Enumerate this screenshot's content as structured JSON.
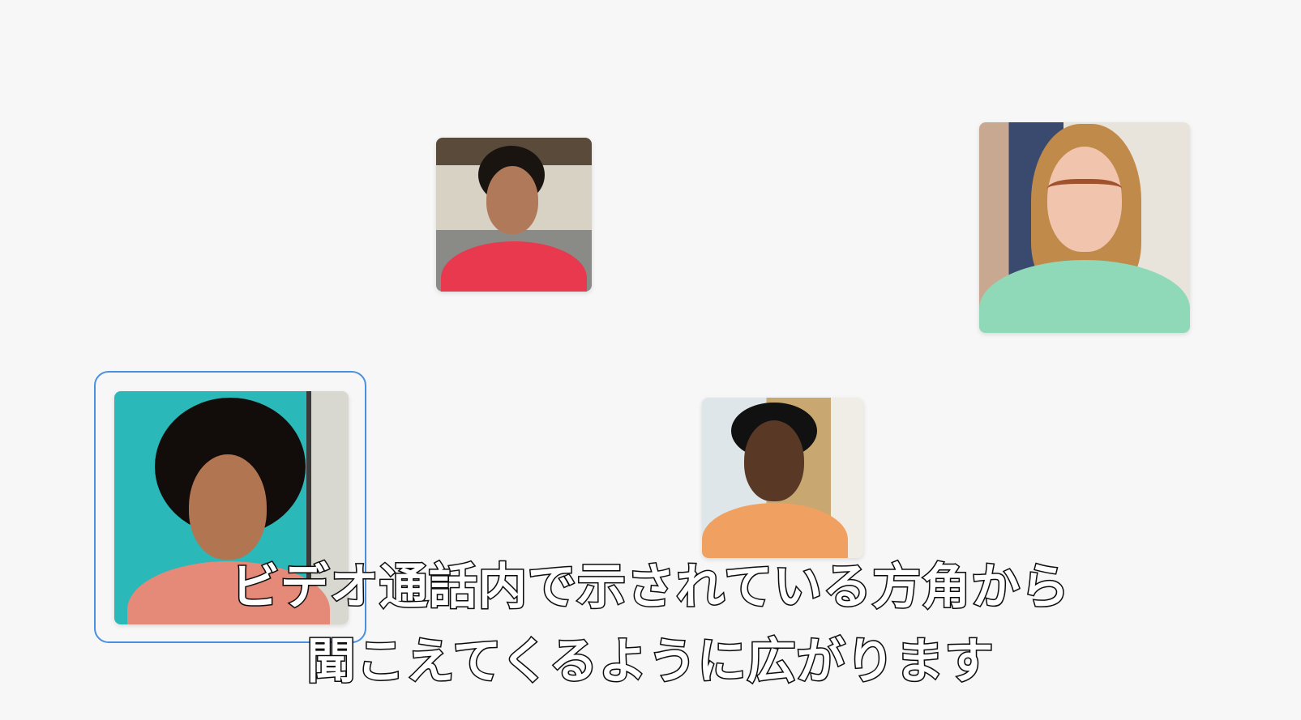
{
  "participants": [
    {
      "label": "participant-1",
      "bg": "#c9c2b5",
      "shirt": "#e8394f",
      "skin": "#b07a5a",
      "hair": "#1a1410"
    },
    {
      "label": "participant-2",
      "bg": "#3a4a6e",
      "shirt": "#8fd9b8",
      "skin": "#f0c4ad",
      "hair": "#c08a4a"
    },
    {
      "label": "participant-3",
      "bg": "#2ab8b8",
      "shirt": "#e58a78",
      "skin": "#b27552",
      "hair": "#120d0a"
    },
    {
      "label": "participant-4",
      "bg": "#d9cdb8",
      "shirt": "#f0a060",
      "skin": "#5a3826",
      "hair": "#111"
    }
  ],
  "selection_color": "#4a90e2",
  "subtitles": {
    "line1": "ビデオ通話内で示されている方角から",
    "line2": "聞こえてくるように広がります"
  }
}
